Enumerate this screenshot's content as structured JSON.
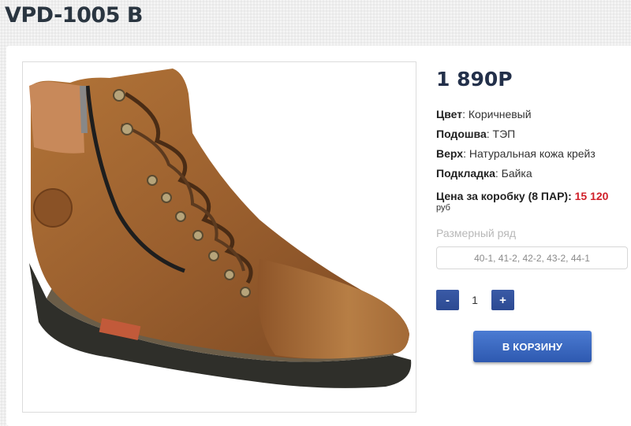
{
  "product": {
    "title": "VPD-1005 B",
    "price": "1 890Р",
    "props": [
      {
        "label": "Цвет",
        "value": " Коричневый"
      },
      {
        "label": "Подошва",
        "value": " ТЭП"
      },
      {
        "label": "Верх",
        "value": " Натуральная кожа крейз"
      },
      {
        "label": "Подкладка",
        "value": " Байка"
      }
    ],
    "colon": ":",
    "box_price_label": "Цена за коробку (8 ПАР): ",
    "box_price_value": "15 120",
    "box_price_unit": "руб"
  },
  "size": {
    "label": "Размерный ряд",
    "selected": "40-1, 41-2, 42-2, 43-2, 44-1"
  },
  "quantity": {
    "minus_label": "-",
    "value": "1",
    "plus_label": "+"
  },
  "cart": {
    "button_label": "В КОРЗИНУ"
  },
  "colors": {
    "accent": "#2c4a92",
    "price_highlight": "#d0202a",
    "boot_leather": "#9a5f2e",
    "sole": "#2f2f2a"
  }
}
